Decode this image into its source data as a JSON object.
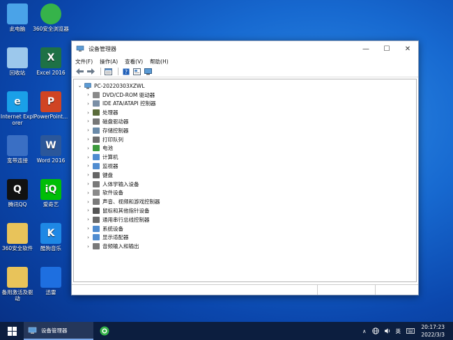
{
  "desktop": {
    "icons": [
      {
        "label": "此电脑",
        "icon": "computer-icon",
        "color": "#4aa3e8"
      },
      {
        "label": "360安全浏览器",
        "icon": "browser-360-icon",
        "color": "#36b34a"
      },
      {
        "label": "回收站",
        "icon": "recycle-bin-icon",
        "color": "#9cc8ec"
      },
      {
        "label": "Excel 2016",
        "icon": "excel-icon",
        "color": "#1e7145"
      },
      {
        "label": "Internet Explorer",
        "icon": "ie-icon",
        "color": "#1aa0e8"
      },
      {
        "label": "PowerPoint...",
        "icon": "powerpoint-icon",
        "color": "#d04423"
      },
      {
        "label": "宽带连接",
        "icon": "broadband-icon",
        "color": "#3a6fc4"
      },
      {
        "label": "Word 2016",
        "icon": "word-icon",
        "color": "#2b579a"
      },
      {
        "label": "腾讯QQ",
        "icon": "qq-icon",
        "color": "#111111"
      },
      {
        "label": "爱奇艺",
        "icon": "iqiyi-icon",
        "color": "#00be06"
      },
      {
        "label": "360安全软件",
        "icon": "folder-icon",
        "color": "#e8c35a"
      },
      {
        "label": "酷狗音乐",
        "icon": "kugou-icon",
        "color": "#1e88e5"
      },
      {
        "label": "备用激活及驱动",
        "icon": "folder-icon",
        "color": "#e8c35a"
      },
      {
        "label": "迅雷",
        "icon": "xunlei-icon",
        "color": "#1e6fe0"
      }
    ]
  },
  "window": {
    "title": "设备管理器",
    "controls": {
      "minimize": "—",
      "maximize": "☐",
      "close": "✕"
    },
    "menu": [
      "文件(F)",
      "操作(A)",
      "查看(V)",
      "帮助(H)"
    ],
    "tree": {
      "root": "PC-20220303XZWL",
      "root_glyph": "⌄",
      "expand_glyph": "›",
      "items": [
        "DVD/CD-ROM 驱动器",
        "IDE ATA/ATAPI 控制器",
        "处理器",
        "磁盘驱动器",
        "存储控制器",
        "打印队列",
        "电池",
        "计算机",
        "监视器",
        "键盘",
        "人体学输入设备",
        "软件设备",
        "声音、视频和游戏控制器",
        "鼠标和其他指针设备",
        "通用串行总线控制器",
        "系统设备",
        "显示适配器",
        "音频输入和输出"
      ]
    }
  },
  "taskbar": {
    "task_label": "设备管理器",
    "tray": {
      "chevron": "∧",
      "ime": "英"
    },
    "clock_time": "20:17:23",
    "clock_date": "2022/3/3"
  },
  "colors": {
    "taskbar": "#0c1e3f",
    "accent": "#1769d0"
  }
}
